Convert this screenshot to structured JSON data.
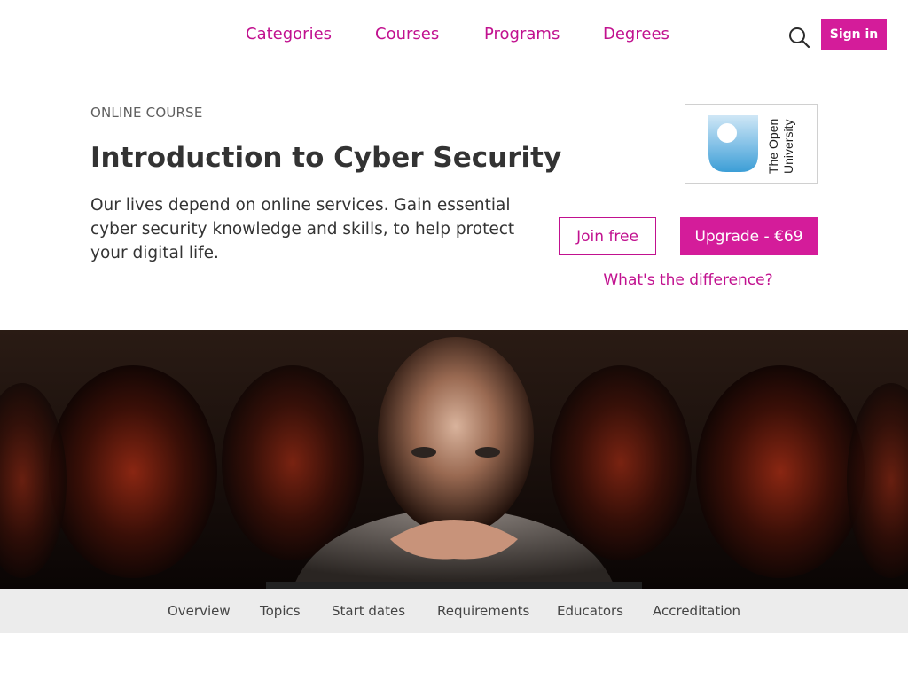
{
  "nav": {
    "items": [
      {
        "label": "Categories"
      },
      {
        "label": "Courses"
      },
      {
        "label": "Programs"
      },
      {
        "label": "Degrees"
      }
    ],
    "search_icon": "search-icon",
    "signin_label": "Sign in"
  },
  "course": {
    "eyebrow": "ONLINE COURSE",
    "title": "Introduction to Cyber Security",
    "description": "Our lives depend on online services. Gain essential cyber security knowledge and skills, to help protect your digital life."
  },
  "partner": {
    "name": "The Open University",
    "logo_line1": "The Open",
    "logo_line2": "University"
  },
  "cta": {
    "join_label": "Join free",
    "upgrade_label": "Upgrade - €69",
    "difference_label": "What's the difference?"
  },
  "tabs": [
    {
      "label": "Overview"
    },
    {
      "label": "Topics"
    },
    {
      "label": "Start dates"
    },
    {
      "label": "Requirements"
    },
    {
      "label": "Educators"
    },
    {
      "label": "Accreditation"
    }
  ],
  "colors": {
    "accent": "#c1118f",
    "accent_fill": "#d41c9a",
    "tabs_bg": "#ececec"
  }
}
